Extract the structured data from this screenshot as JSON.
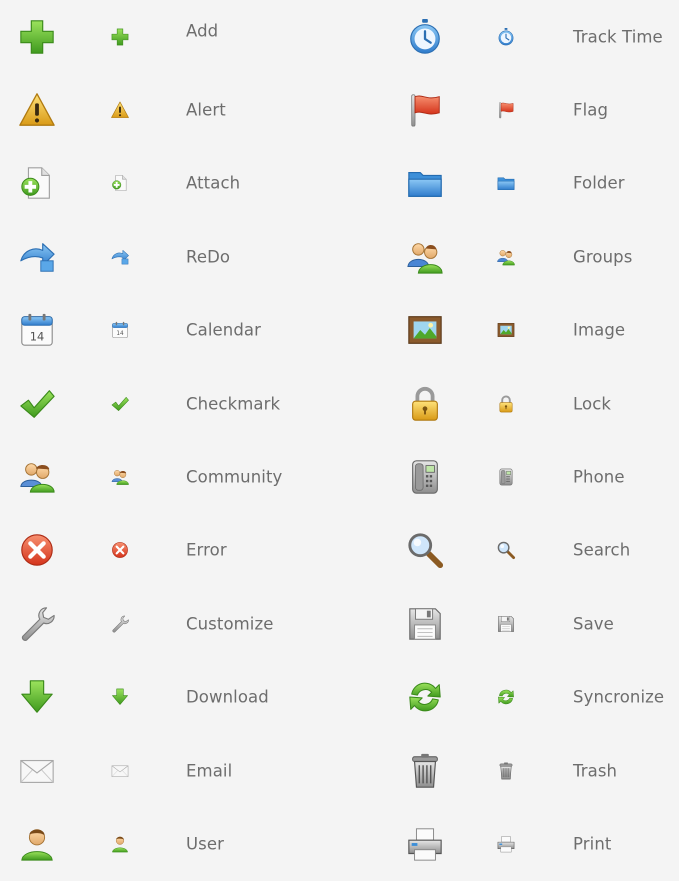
{
  "left_column": [
    {
      "icon": "add-icon",
      "label": "Add"
    },
    {
      "icon": "alert-icon",
      "label": "Alert"
    },
    {
      "icon": "attach-icon",
      "label": "Attach"
    },
    {
      "icon": "redo-icon",
      "label": "ReDo"
    },
    {
      "icon": "calendar-icon",
      "label": "Calendar",
      "calendar_day": "14"
    },
    {
      "icon": "checkmark-icon",
      "label": "Checkmark"
    },
    {
      "icon": "community-icon",
      "label": "Community"
    },
    {
      "icon": "error-icon",
      "label": "Error"
    },
    {
      "icon": "customize-icon",
      "label": "Customize"
    },
    {
      "icon": "download-icon",
      "label": "Download"
    },
    {
      "icon": "email-icon",
      "label": "Email"
    },
    {
      "icon": "user-icon",
      "label": "User"
    }
  ],
  "right_column": [
    {
      "icon": "track-time-icon",
      "label": "Track Time"
    },
    {
      "icon": "flag-icon",
      "label": "Flag"
    },
    {
      "icon": "folder-icon",
      "label": "Folder"
    },
    {
      "icon": "groups-icon",
      "label": "Groups"
    },
    {
      "icon": "image-icon",
      "label": "Image"
    },
    {
      "icon": "lock-icon",
      "label": "Lock"
    },
    {
      "icon": "phone-icon",
      "label": "Phone"
    },
    {
      "icon": "search-icon",
      "label": "Search"
    },
    {
      "icon": "save-icon",
      "label": "Save"
    },
    {
      "icon": "syncronize-icon",
      "label": "Syncronize"
    },
    {
      "icon": "trash-icon",
      "label": "Trash"
    },
    {
      "icon": "print-icon",
      "label": "Print"
    }
  ],
  "colors": {
    "background": "#f4f4f4",
    "label": "#6d6d6d",
    "green": "#5cb82e",
    "blue": "#3d8fd8",
    "red": "#e44b2c",
    "gold": "#e8b52a",
    "gray": "#8a8a8a"
  }
}
